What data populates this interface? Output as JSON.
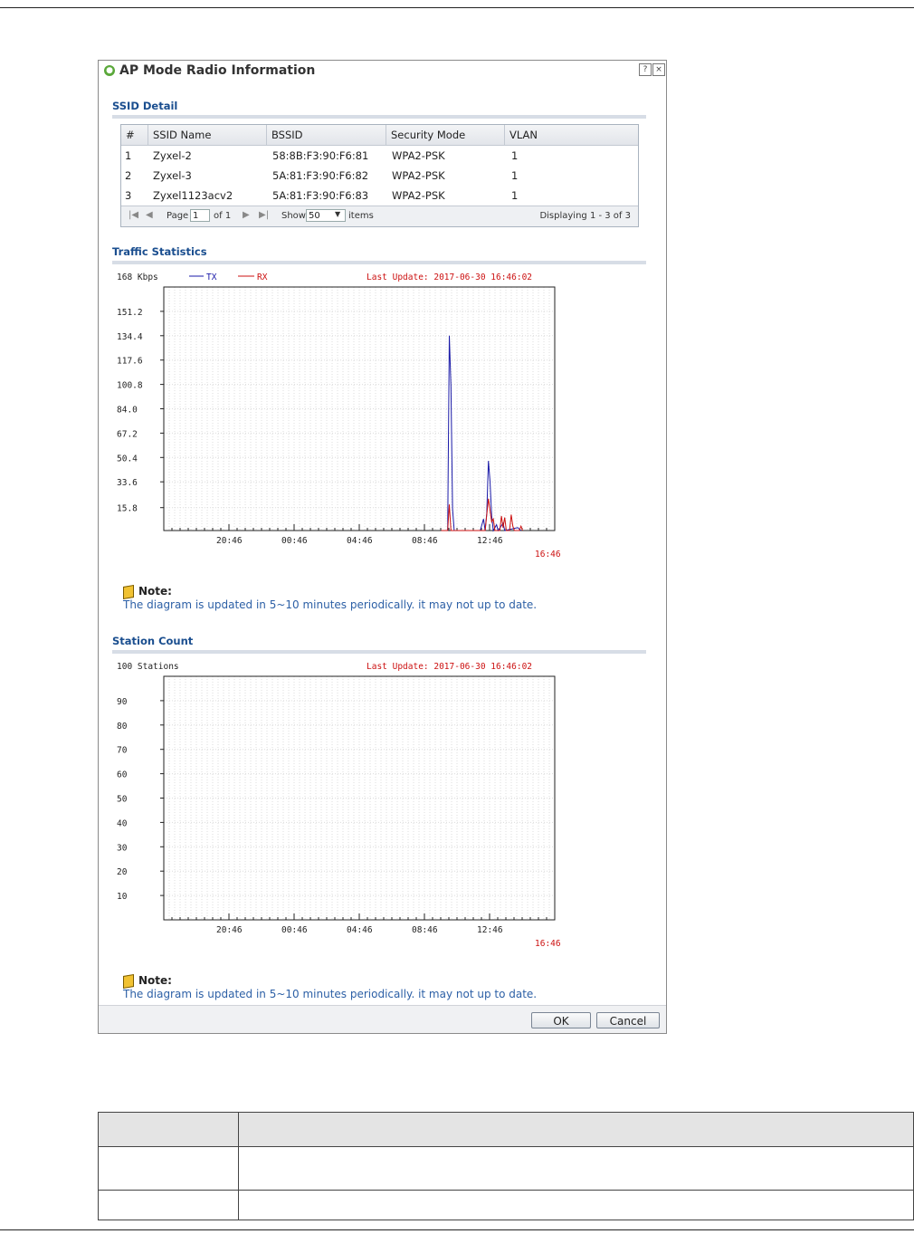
{
  "window": {
    "title": "AP Mode Radio Information",
    "help_icon": "?",
    "close_icon": "×"
  },
  "ssid_detail": {
    "title": "SSID Detail",
    "columns": [
      "#",
      "SSID Name",
      "BSSID",
      "Security Mode",
      "VLAN"
    ],
    "rows": [
      [
        "1",
        "Zyxel-2",
        "58:8B:F3:90:F6:81",
        "WPA2-PSK",
        "1"
      ],
      [
        "2",
        "Zyxel-3",
        "5A:81:F3:90:F6:82",
        "WPA2-PSK",
        "1"
      ],
      [
        "3",
        "Zyxel1123acv2",
        "5A:81:F3:90:F6:83",
        "WPA2-PSK",
        "1"
      ]
    ],
    "pager": {
      "page_label": "Page",
      "page_value": "1",
      "of_label": "of 1",
      "show_label": "Show",
      "show_value": "50",
      "items_label": "items",
      "displaying": "Displaying 1 - 3 of 3"
    }
  },
  "traffic": {
    "title": "Traffic Statistics",
    "unit_label": "168 Kbps",
    "legend_tx": "TX",
    "legend_rx": "RX",
    "last_update": "Last Update: 2017-06-30 16:46:02",
    "current_time": "16:46",
    "note_label": "Note:",
    "note_text": "The diagram is updated in 5~10 minutes periodically. it may not up to date."
  },
  "station": {
    "title": "Station Count",
    "unit_label": "100 Stations",
    "last_update": "Last Update: 2017-06-30 16:46:02",
    "current_time": "16:46",
    "note_label": "Note:",
    "note_text": "The diagram is updated in 5~10 minutes periodically. it may not up to date."
  },
  "buttons": {
    "ok": "OK",
    "cancel": "Cancel"
  },
  "colors": {
    "tx": "#1a1aa8",
    "rx": "#cc1111",
    "section": "#1a4e8f",
    "note": "#2d60a6"
  },
  "chart_data": [
    {
      "type": "line",
      "title": "",
      "ylabel": "168 Kbps",
      "ylim": [
        0,
        168
      ],
      "yticks": [
        15.8,
        33.6,
        50.4,
        67.2,
        84.0,
        100.8,
        117.6,
        134.4,
        151.2
      ],
      "xticks": [
        "20:46",
        "00:46",
        "04:46",
        "08:46",
        "12:46"
      ],
      "x_hours": [
        20.77,
        24.77,
        28.77,
        32.77,
        36.77
      ],
      "xlim_hours": [
        16.77,
        40.77
      ],
      "series": [
        {
          "name": "TX",
          "color": "#1a1aa8",
          "points": [
            [
              33.8,
              0
            ],
            [
              34.2,
              0
            ],
            [
              34.3,
              134.4
            ],
            [
              34.4,
              100
            ],
            [
              34.5,
              15
            ],
            [
              34.6,
              0
            ],
            [
              36.2,
              0
            ],
            [
              36.4,
              8
            ],
            [
              36.5,
              0
            ],
            [
              36.6,
              12
            ],
            [
              36.7,
              48
            ],
            [
              36.8,
              34
            ],
            [
              36.9,
              10
            ],
            [
              37.0,
              0
            ],
            [
              37.2,
              4
            ],
            [
              37.3,
              0
            ],
            [
              37.6,
              5
            ],
            [
              37.7,
              0
            ],
            [
              38.5,
              2
            ],
            [
              38.7,
              0
            ]
          ]
        },
        {
          "name": "RX",
          "color": "#cc1111",
          "points": [
            [
              33.8,
              0
            ],
            [
              34.2,
              0
            ],
            [
              34.3,
              18
            ],
            [
              34.4,
              0
            ],
            [
              34.6,
              0
            ],
            [
              36.5,
              0
            ],
            [
              36.7,
              22
            ],
            [
              36.8,
              14
            ],
            [
              36.9,
              6
            ],
            [
              37.0,
              8
            ],
            [
              37.1,
              0
            ],
            [
              37.4,
              0
            ],
            [
              37.5,
              10
            ],
            [
              37.6,
              2
            ],
            [
              37.7,
              9
            ],
            [
              37.8,
              0
            ],
            [
              38.0,
              0
            ],
            [
              38.1,
              11
            ],
            [
              38.2,
              3
            ],
            [
              38.3,
              0
            ],
            [
              38.6,
              0
            ],
            [
              38.7,
              3
            ],
            [
              38.8,
              0
            ]
          ]
        }
      ]
    },
    {
      "type": "line",
      "title": "",
      "ylabel": "100 Stations",
      "ylim": [
        0,
        100
      ],
      "yticks": [
        10,
        20,
        30,
        40,
        50,
        60,
        70,
        80,
        90
      ],
      "xticks": [
        "20:46",
        "00:46",
        "04:46",
        "08:46",
        "12:46"
      ],
      "x_hours": [
        20.77,
        24.77,
        28.77,
        32.77,
        36.77
      ],
      "xlim_hours": [
        16.77,
        40.77
      ],
      "series": []
    }
  ]
}
